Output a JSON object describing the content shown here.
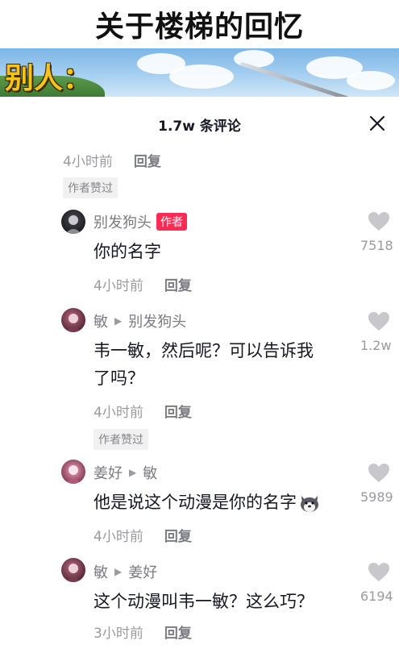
{
  "video": {
    "title": "关于楼梯的回忆",
    "banner_label": "别人："
  },
  "comments_panel": {
    "title": "1.7w 条评论"
  },
  "prev_meta": {
    "time": "4小时前",
    "reply": "回复",
    "author_liked": "作者赞过"
  },
  "comments": [
    {
      "name": "别发狗头",
      "badge": "作者",
      "text": "你的名字",
      "time": "4小时前",
      "reply": "回复",
      "likes": "7518"
    },
    {
      "name": "敏",
      "reply_to": "别发狗头",
      "text_line1": "韦一敏，然后呢？可以告诉我",
      "text_line2": "了吗？",
      "time": "4小时前",
      "reply": "回复",
      "likes": "1.2w",
      "author_liked": "作者赞过"
    },
    {
      "name": "姜好",
      "reply_to": "敏",
      "text": "他是说这个动漫是你的名字",
      "emoji": "dog-icon",
      "time": "4小时前",
      "reply": "回复",
      "likes": "5989"
    },
    {
      "name": "敏",
      "reply_to": "姜好",
      "text": "这个动漫叫韦一敏？这么巧？",
      "time": "3小时前",
      "reply": "回复",
      "likes": "6194"
    }
  ],
  "colors": {
    "author_badge": "#fe2c55",
    "muted_text": "#9a9ba0",
    "banner_label": "#f6c21d"
  }
}
